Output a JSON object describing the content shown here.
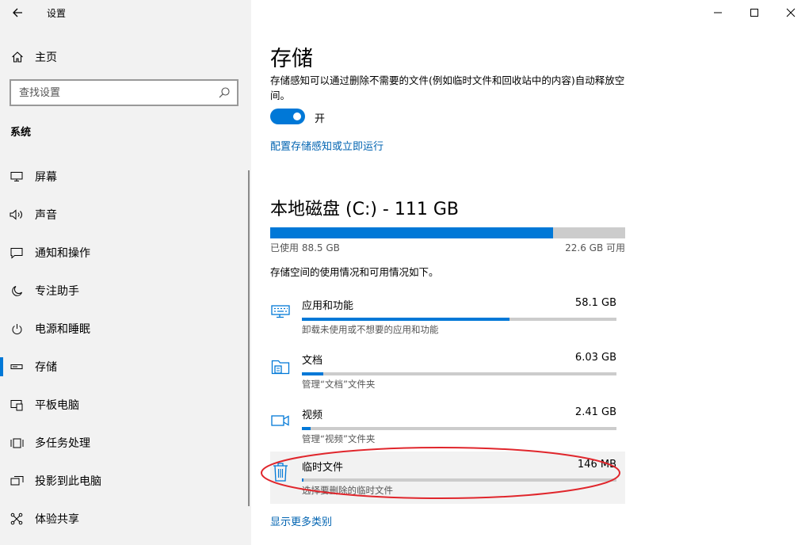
{
  "app": {
    "title": "设置"
  },
  "sidebar": {
    "home_label": "主页",
    "search_placeholder": "查找设置",
    "section": "系统",
    "items": [
      {
        "label": "屏幕",
        "icon": "monitor-icon"
      },
      {
        "label": "声音",
        "icon": "speaker-icon"
      },
      {
        "label": "通知和操作",
        "icon": "notification-icon"
      },
      {
        "label": "专注助手",
        "icon": "moon-icon"
      },
      {
        "label": "电源和睡眠",
        "icon": "power-icon"
      },
      {
        "label": "存储",
        "icon": "storage-icon",
        "active": true
      },
      {
        "label": "平板电脑",
        "icon": "tablet-icon"
      },
      {
        "label": "多任务处理",
        "icon": "multitask-icon"
      },
      {
        "label": "投影到此电脑",
        "icon": "project-icon"
      },
      {
        "label": "体验共享",
        "icon": "share-icon"
      }
    ]
  },
  "main": {
    "title": "存储",
    "desc": "存储感知可以通过删除不需要的文件(例如临时文件和回收站中的内容)自动释放空间。",
    "toggle_state": "开",
    "toggle_on": true,
    "config_link": "配置存储感知或立即运行",
    "disk": {
      "title": "本地磁盘 (C:) - 111 GB",
      "used_label": "已使用 88.5 GB",
      "free_label": "22.6 GB 可用",
      "used_fraction": 0.797
    },
    "summary": "存储空间的使用情况和可用情况如下。",
    "categories": [
      {
        "name": "应用和功能",
        "size": "58.1 GB",
        "desc": "卸载未使用或不想要的应用和功能",
        "fraction": 0.66,
        "icon": "keyboard-icon"
      },
      {
        "name": "文档",
        "size": "6.03 GB",
        "desc": "管理“文档”文件夹",
        "fraction": 0.068,
        "icon": "folder-icon"
      },
      {
        "name": "视频",
        "size": "2.41 GB",
        "desc": "管理“视频”文件夹",
        "fraction": 0.027,
        "icon": "video-icon"
      },
      {
        "name": "临时文件",
        "size": "146 MB",
        "desc": "选择要删除的临时文件",
        "fraction": 0.003,
        "icon": "trash-icon",
        "highlighted": true
      }
    ],
    "more_link": "显示更多类别"
  },
  "colors": {
    "accent": "#0078d7",
    "link": "#0063b1",
    "annotation": "#e0262c"
  }
}
